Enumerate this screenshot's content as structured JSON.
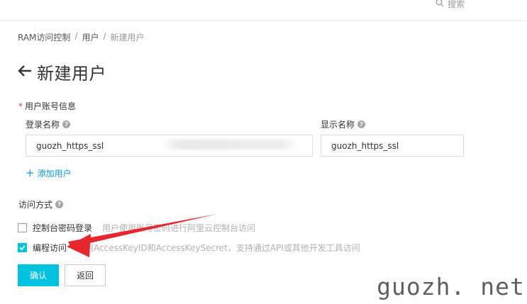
{
  "topbar": {
    "search_label": "搜索",
    "search_icon": "search-icon"
  },
  "breadcrumb": {
    "items": [
      "RAM访问控制",
      "用户",
      "新建用户"
    ],
    "separator": "/"
  },
  "page": {
    "back_icon": "arrow-left-icon",
    "title": "新建用户"
  },
  "user_info": {
    "required_mark": "*",
    "section_label": "用户账号信息",
    "login_name_label": "登录名称",
    "login_name_value": "guozh_https_ssl",
    "display_name_label": "显示名称",
    "display_name_value": "guozh_https_ssl",
    "help_icon": "help-icon",
    "help_glyph": "?",
    "add_user_plus": "+",
    "add_user_label": "添加用户"
  },
  "access": {
    "label": "访问方式",
    "console_login_label": "控制台密码登录",
    "console_login_desc": "用户使用账号密码进行阿里云控制台访问",
    "console_login_checked": false,
    "programmatic_label": "编程访问",
    "programmatic_desc": "启用AccessKeyID和AccessKeySecret，支持通过API或其他开发工具访问",
    "programmatic_checked": true
  },
  "buttons": {
    "confirm": "确认",
    "back": "返回"
  },
  "watermark": {
    "text": "guozh. net"
  },
  "colors": {
    "primary": "#00c1de",
    "link": "#0a98d6",
    "required": "#e64552",
    "annotation_arrow": "#e8262e"
  }
}
